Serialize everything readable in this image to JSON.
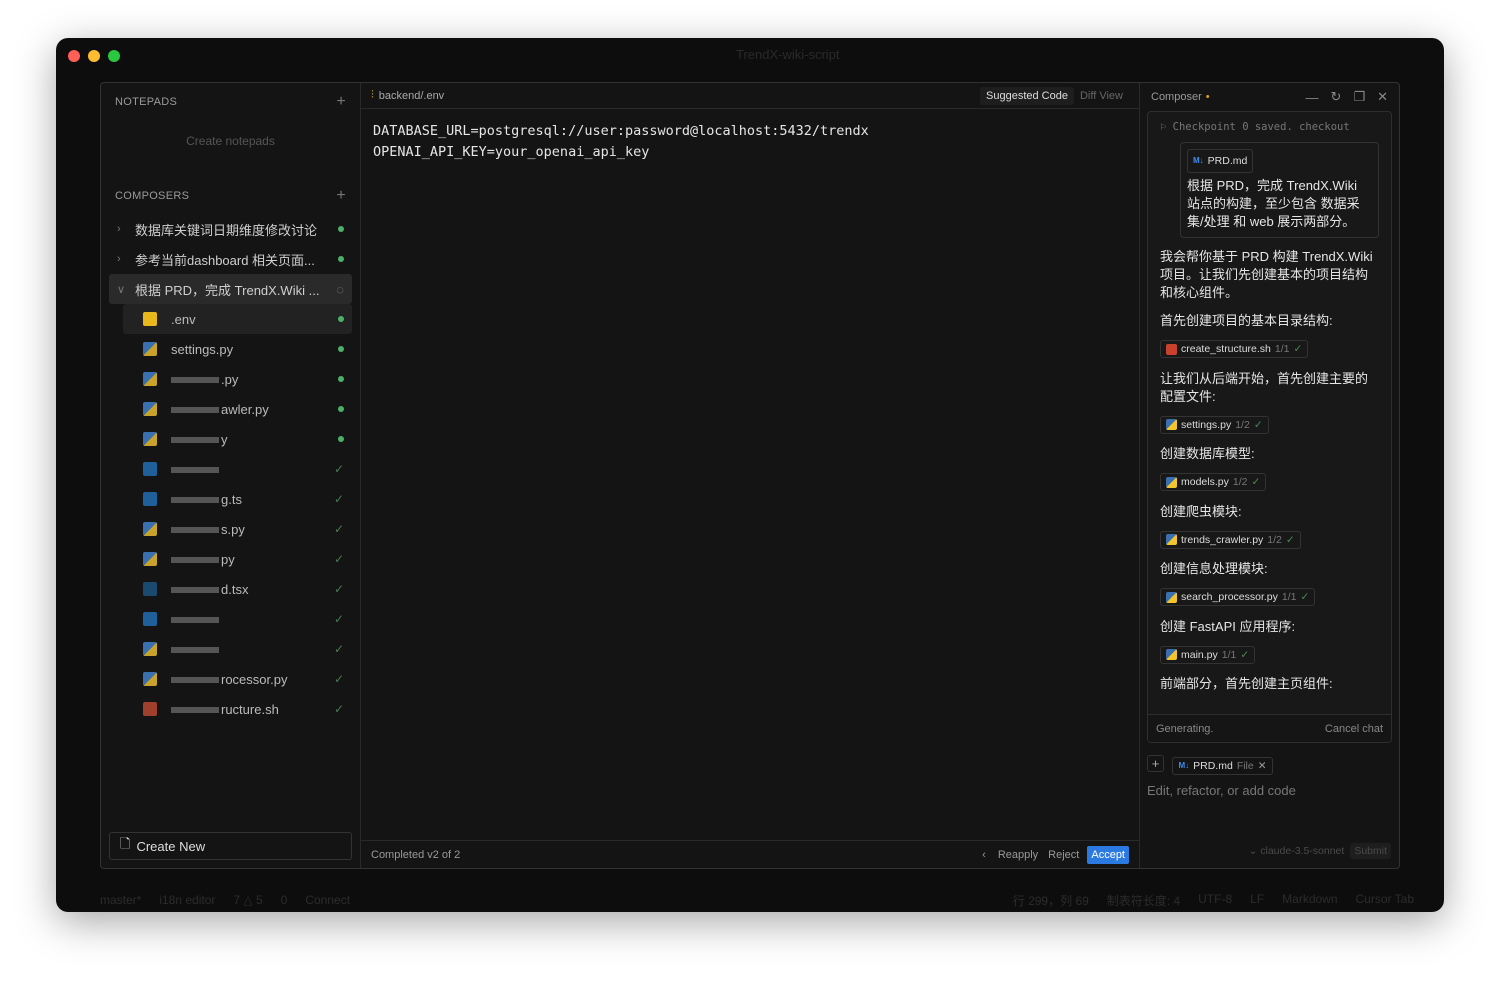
{
  "window": {
    "title": "TrendX-wiki-script"
  },
  "statusbar": {
    "branch": "master*",
    "editor": "i18n editor",
    "problems": "7 △ 5",
    "ports": "0",
    "connect": "Connect",
    "position": "行 299，列 69",
    "tab_size": "制表符长度: 4",
    "encoding": "UTF-8",
    "eol": "LF",
    "language": "Markdown",
    "cursor_tab": "Cursor Tab"
  },
  "notepads": {
    "title": "NOTEPADS",
    "empty": "Create notepads"
  },
  "composers": {
    "title": "COMPOSERS",
    "items": [
      {
        "label": "数据库关键词日期维度修改讨论",
        "status": "done"
      },
      {
        "label": "参考当前dashboard 相关页面...",
        "status": "done"
      },
      {
        "label": "根据 PRD，完成 TrendX.Wiki ...",
        "status": "loading"
      }
    ],
    "files": [
      {
        "name": ".env",
        "icon": "env",
        "status": "dot"
      },
      {
        "name": "settings.py",
        "icon": "python",
        "status": "dot"
      },
      {
        "name": ".py",
        "icon": "python",
        "status": "dot"
      },
      {
        "name": "awler.py",
        "icon": "python",
        "status": "dot"
      },
      {
        "name": "y",
        "icon": "python",
        "status": "dot"
      },
      {
        "name": "",
        "icon": "typescript",
        "status": "check"
      },
      {
        "name": "g.ts",
        "icon": "typescript",
        "status": "check"
      },
      {
        "name": "s.py",
        "icon": "python",
        "status": "check"
      },
      {
        "name": "py",
        "icon": "python",
        "status": "check"
      },
      {
        "name": "d.tsx",
        "icon": "react",
        "status": "check"
      },
      {
        "name": "",
        "icon": "typescript",
        "status": "check"
      },
      {
        "name": "",
        "icon": "python",
        "status": "check"
      },
      {
        "name": "rocessor.py",
        "icon": "python",
        "status": "check"
      },
      {
        "name": "ructure.sh",
        "icon": "shell",
        "status": "check"
      }
    ],
    "create_new": "Create New"
  },
  "editor": {
    "path": "backend/.env",
    "tabs": [
      "Suggested Code",
      "Diff View"
    ],
    "code": [
      "DATABASE_URL=postgresql://user:password@localhost:5432/trendx",
      "OPENAI_API_KEY=your_openai_api_key"
    ],
    "footer": {
      "status": "Completed v2 of 2",
      "reapply": "Reapply",
      "reject": "Reject",
      "accept": "Accept"
    }
  },
  "composer": {
    "title": "Composer",
    "checkpoint": "Checkpoint 0 saved. checkout",
    "user_file": "PRD.md",
    "user_msg": "根据 PRD，完成 TrendX.Wiki 站点的构建，至少包含 数据采集/处理 和 web 展示两部分。",
    "messages": [
      {
        "text": "我会帮你基于 PRD 构建 TrendX.Wiki 项目。让我们先创建基本的项目结构和核心组件。"
      },
      {
        "text": "首先创建项目的基本目录结构:",
        "file": "create_structure.sh",
        "ver": "1/1",
        "icon": "shell"
      },
      {
        "text": "让我们从后端开始，首先创建主要的配置文件:",
        "file": "settings.py",
        "ver": "1/2",
        "icon": "python"
      },
      {
        "text": "创建数据库模型:",
        "file": "models.py",
        "ver": "1/2",
        "icon": "python"
      },
      {
        "text": "创建爬虫模块:",
        "file": "trends_crawler.py",
        "ver": "1/2",
        "icon": "python"
      },
      {
        "text": "创建信息处理模块:",
        "file": "search_processor.py",
        "ver": "1/1",
        "icon": "python"
      },
      {
        "text": "创建 FastAPI 应用程序:",
        "file": "main.py",
        "ver": "1/1",
        "icon": "python"
      },
      {
        "text": "前端部分，首先创建主页组件:"
      }
    ],
    "generating": "Generating.",
    "cancel": "Cancel chat",
    "context_file": "PRD.md",
    "context_type": "File",
    "placeholder": "Edit, refactor, or add code",
    "model": "claude-3.5-sonnet",
    "submit": "Submit"
  },
  "colors": {
    "accent": "#2a7ae2",
    "success": "#4caf6a",
    "env_icon": "#e8b71c"
  }
}
